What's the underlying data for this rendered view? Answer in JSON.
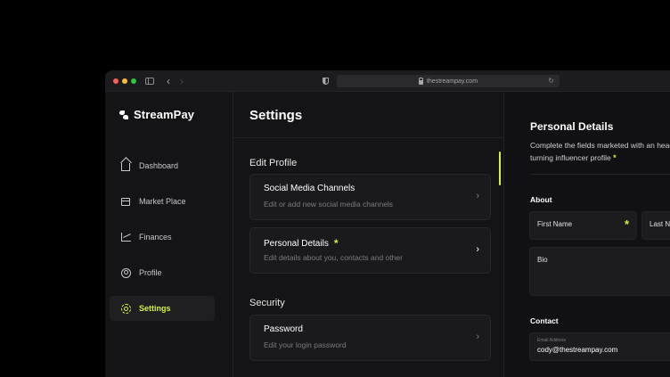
{
  "browser": {
    "url": "thestreampay.com"
  },
  "brand": {
    "name": "StreamPay"
  },
  "sidebar": {
    "items": [
      {
        "label": "Dashboard",
        "icon": "home-icon"
      },
      {
        "label": "Market Place",
        "icon": "store-icon"
      },
      {
        "label": "Finances",
        "icon": "chart-icon"
      },
      {
        "label": "Profile",
        "icon": "profile-icon"
      },
      {
        "label": "Settings",
        "icon": "gear-icon",
        "active": true
      }
    ]
  },
  "settings": {
    "title": "Settings",
    "edit_profile": {
      "heading": "Edit Profile",
      "cards": [
        {
          "title": "Social Media Channels",
          "subtitle": "Edit or add new social media channels"
        },
        {
          "title": "Personal Details",
          "subtitle": "Edit details about you, contacts and other",
          "required_mark": "*"
        }
      ]
    },
    "security": {
      "heading": "Security",
      "cards": [
        {
          "title": "Password",
          "subtitle": "Edit your login password"
        }
      ]
    }
  },
  "personal_details": {
    "title": "Personal Details",
    "description": "Complete the fields marketed with an head-turning influencer profile",
    "required_mark": "*",
    "about": {
      "heading": "About",
      "first_name_label": "First Name",
      "last_name_label": "Last Na",
      "bio_label": "Bio"
    },
    "contact": {
      "heading": "Contact",
      "email_label": "Email Address",
      "email_value": "cody@thestreampay.com"
    }
  },
  "colors": {
    "accent": "#d6f03c",
    "background": "#141416",
    "card": "#1a1a1d"
  }
}
